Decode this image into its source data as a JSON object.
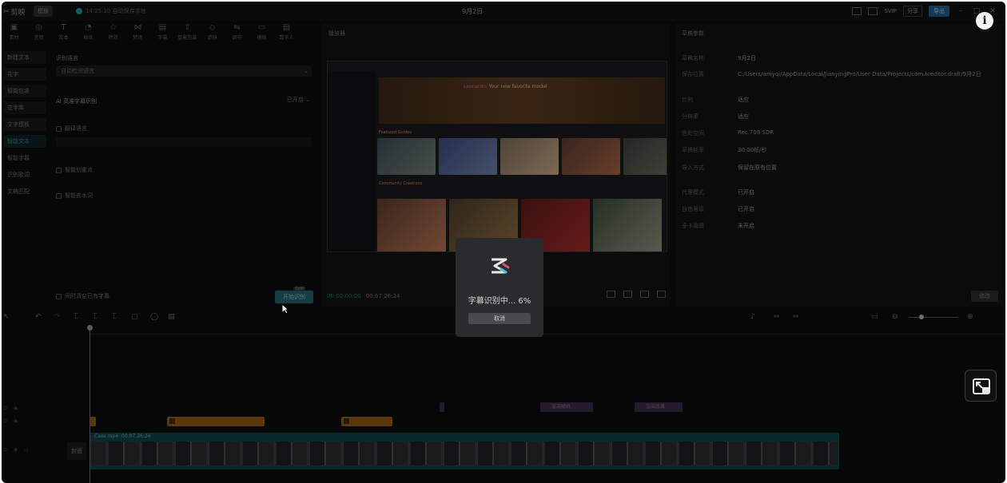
{
  "app": {
    "brand": "剪映",
    "layout_button": "模板",
    "autosave": "14:25:10 自动保存本地",
    "title": "9月2日",
    "svip": "SVIP",
    "share": "分享",
    "export": "导出"
  },
  "toolbar": [
    {
      "label": "素材",
      "glyph": "▣"
    },
    {
      "label": "音频",
      "glyph": "◎"
    },
    {
      "label": "文本",
      "glyph": "T",
      "active": true
    },
    {
      "label": "贴纸",
      "glyph": "◔"
    },
    {
      "label": "特效",
      "glyph": "☆"
    },
    {
      "label": "转场",
      "glyph": "⋈"
    },
    {
      "label": "字幕",
      "glyph": "▤"
    },
    {
      "label": "智能包装",
      "glyph": "⇪"
    },
    {
      "label": "滤镜",
      "glyph": "◇"
    },
    {
      "label": "调节",
      "glyph": "⇋"
    },
    {
      "label": "模板",
      "glyph": "▭"
    },
    {
      "label": "数字人",
      "glyph": "▤"
    }
  ],
  "left_nav": [
    {
      "label": "新建文本"
    },
    {
      "label": "花字"
    },
    {
      "label": "智能包装"
    },
    {
      "label": "花字库"
    },
    {
      "label": "文字模板"
    },
    {
      "label": "智能文本",
      "active": true
    },
    {
      "label": "智能字幕",
      "plain": true
    },
    {
      "label": "识别歌词",
      "plain": true
    },
    {
      "label": "文稿匹配",
      "plain": true
    }
  ],
  "left_content": {
    "language_label": "识别语言",
    "language_value": "自动检测语言",
    "ai_label": "AI 高准字幕识别",
    "ai_status": "已开启",
    "bilingual": "翻译语言",
    "smart_mark": "智能划重点",
    "remove_filler": "智能去水词",
    "clear_existing": "同时清空已有字幕",
    "start_button": "开始识别",
    "svip_tag": "SVIP"
  },
  "player": {
    "title": "播放器",
    "current_time": "00:00:00:00",
    "total_time": "00:07:26:24",
    "video": {
      "hero_prefix": "Leonardo.",
      "hero_title": "Your new favorite model",
      "section1": "Featured Guides",
      "section2": "Community Creations"
    }
  },
  "right_panel": {
    "title": "草稿参数",
    "rows": [
      {
        "label": "草稿名称",
        "value": "9月2日"
      },
      {
        "label": "保存位置",
        "value": "C:/Users/amyqi/AppData/Local/JianyingPro/User Data/Projects/com.lveditor.draft/9月2日"
      },
      {
        "label": "比例",
        "value": "适应"
      },
      {
        "label": "分辨率",
        "value": "适应"
      },
      {
        "label": "色彩空间",
        "value": "Rec.709 SDR"
      },
      {
        "label": "草稿帧率",
        "value": "30.00帧/秒"
      },
      {
        "label": "导入方式",
        "value": "保留在原有位置"
      },
      {
        "label": "代理模式",
        "value": "已开启"
      },
      {
        "label": "自由层级",
        "value": "已开启"
      },
      {
        "label": "多卡编辑",
        "value": "未开启"
      }
    ],
    "modify": "修改"
  },
  "timeline": {
    "clip_file": "Case.mp4",
    "clip_duration": "00:07:26:24",
    "cover": "封面",
    "purple_clips": [
      "渲染随机",
      "渲染效果"
    ]
  },
  "dialog": {
    "status": "字幕识别中... 6%",
    "progress": 0.06,
    "cancel": "取消"
  }
}
